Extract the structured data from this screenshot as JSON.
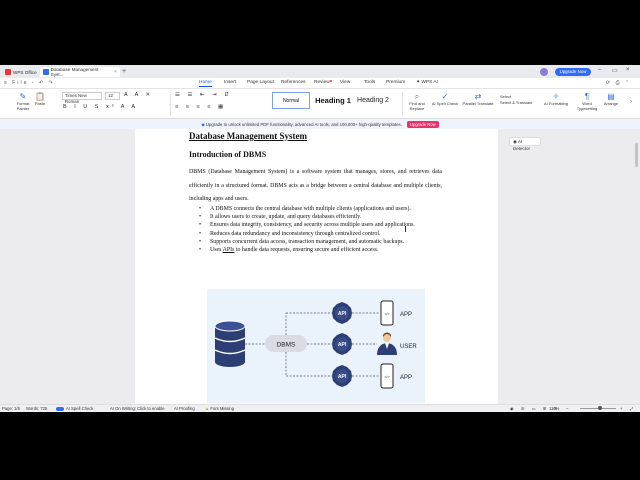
{
  "titlebar": {
    "app_tab": "WPS Office",
    "doc_tab": "Database Management Syst...",
    "upgrade": "Upgrade Now"
  },
  "menu": {
    "items": [
      "Home",
      "Insert",
      "Page Layout",
      "References",
      "Review",
      "View",
      "Tools",
      "Premium",
      "WPS AI"
    ],
    "active": "Home"
  },
  "ribbon": {
    "format_painter": "Format Painter",
    "paste": "Paste",
    "font_name": "Times New Roman",
    "font_size": "12",
    "styles": [
      "Normal",
      "Heading 1",
      "Heading 2"
    ],
    "find_replace": "Find and Replace",
    "spell_check": "AI Spell Check",
    "parallel_translate": "Parallel Translate",
    "select": "Select",
    "select_translate": "Select & Translate",
    "ai_formatting": "AI Formatting",
    "word_typesetting": "Word Typesetting",
    "arrange": "Arrange"
  },
  "banner": {
    "text": "Upgrade to unlock unlimited PDF functionality, advanced AI tools, and 100,000+ high-quality templates.",
    "button": "Upgrade Now"
  },
  "document": {
    "title": "Database Management System",
    "heading": "Introduction of DBMS",
    "paragraph": "DBMS (Database Management System) is a software system that manages, stores, and retrieves data efficiently in a structured format. DBMS acts as a bridge between a central database and multiple clients, including apps and users.",
    "bullets": [
      "A DBMS connects the central database with multiple clients (applications and users).",
      "It allows users to create, update, and query databases efficiently.",
      "Ensures data integrity, consistency, and security across multiple users and applications.",
      "Reduces data redundancy and inconsistency through centralized control.",
      "Supports concurrent data access, transaction management, and automatic backups."
    ],
    "last_bullet_pre": "Uses ",
    "last_bullet_link": "APIs",
    "last_bullet_post": " to handle data requests, ensuring secure and efficient access."
  },
  "diagram": {
    "dbms_label": "DBMS",
    "api_labels": [
      "API",
      "API",
      "API"
    ],
    "client_labels": [
      "APP",
      "USER",
      "APP"
    ],
    "code_glyph": "</>"
  },
  "side_panel": {
    "ai_detector": "AI Detector"
  },
  "statusbar": {
    "page": "Page: 1/6",
    "words": "Words: 725",
    "spell_check": "AI Spell Check",
    "ai_writing": "AI On Writing: Click to enable",
    "ai_proofing": "AI Proofing",
    "font_missing": "Font Missing",
    "zoom": "110%"
  },
  "colors": {
    "accent": "#2f6cf6",
    "banner_button": "#e6336b",
    "diagram_navy": "#2c3e73",
    "diagram_bg": "#eaf3fb"
  }
}
